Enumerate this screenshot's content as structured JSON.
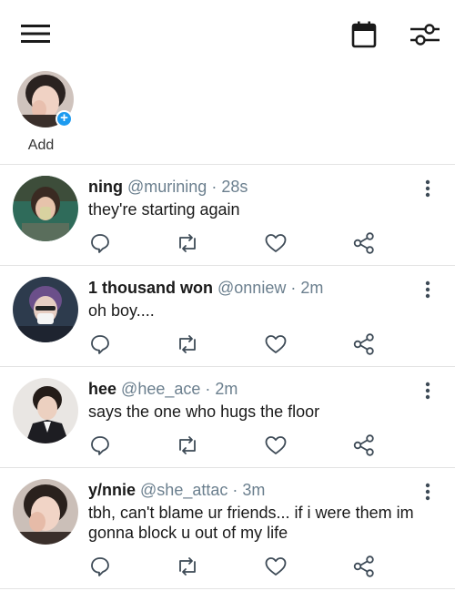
{
  "topbar": {
    "menu_icon": "hamburger-menu-icon",
    "calendar_icon": "calendar-icon",
    "filter_icon": "sliders-filter-icon"
  },
  "story": {
    "label": "Add"
  },
  "colors": {
    "accent": "#1d9bf0",
    "muted": "#6b7f8e",
    "icon": "#3d4a56",
    "divider": "#e3e3e3"
  },
  "posts": [
    {
      "name": "ning",
      "handle": "@murining",
      "sep": "·",
      "time": "28s",
      "text": "they're starting again"
    },
    {
      "name": "1 thousand won",
      "handle": "@onniew",
      "sep": "·",
      "time": "2m",
      "text": "oh boy...."
    },
    {
      "name": "hee",
      "handle": "@hee_ace",
      "sep": "·",
      "time": "2m",
      "text": "says the one who hugs the floor"
    },
    {
      "name": "y/nnie",
      "handle": "@she_attac",
      "sep": "·",
      "time": "3m",
      "text": "tbh, can't blame ur friends... if i were them im gonna block u out of my life"
    }
  ]
}
